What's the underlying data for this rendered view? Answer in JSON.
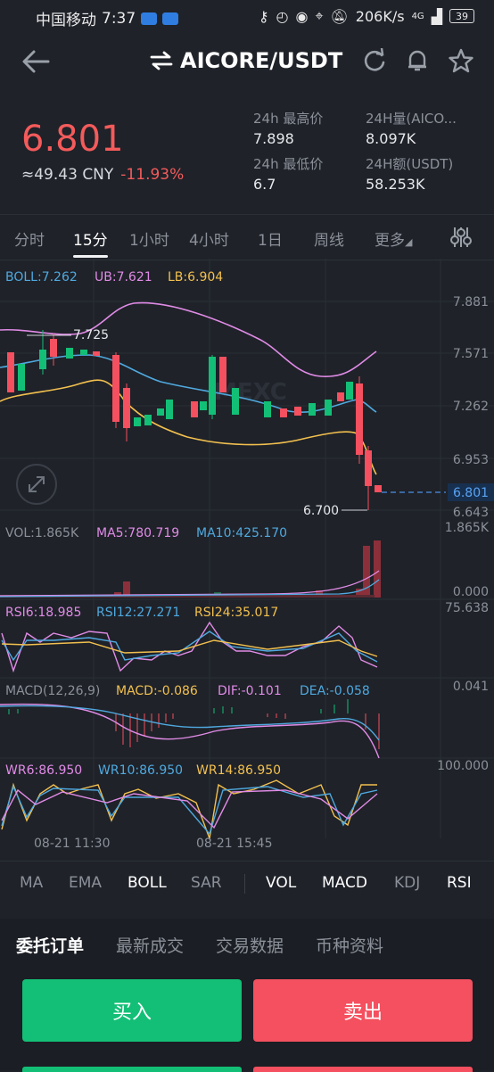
{
  "status": {
    "carrier": "中国移动",
    "time": "7:37",
    "speed": "206K/s",
    "net": "4G",
    "battery": "39"
  },
  "header": {
    "pair": "AICORE/USDT",
    "swap_icon": "swap-icon"
  },
  "price": {
    "last": "6.801",
    "cny": "≈49.43 CNY",
    "change": "-11.93%"
  },
  "stats": [
    {
      "label": "24h 最高价",
      "value": "7.898"
    },
    {
      "label": "24H量(AICO...",
      "value": "8.097K"
    },
    {
      "label": "24h 最低价",
      "value": "6.7"
    },
    {
      "label": "24H额(USDT)",
      "value": "58.253K"
    }
  ],
  "tabs": [
    "分时",
    "15分",
    "1小时",
    "4小时",
    "1日",
    "周线",
    "更多"
  ],
  "boll": {
    "boll": "BOLL:7.262",
    "ub": "UB:7.621",
    "lb": "LB:6.904"
  },
  "price_axis": [
    "7.881",
    "7.571",
    "7.262",
    "6.953",
    "6.643"
  ],
  "price_tag": "6.801",
  "annot_high": "7.725",
  "annot_low": "6.700",
  "vol": {
    "vol": "VOL:1.865K",
    "ma5": "MA5:780.719",
    "ma10": "MA10:425.170",
    "top": "1.865K",
    "bottom": "0.000"
  },
  "rsi": {
    "r6": "RSI6:18.985",
    "r12": "RSI12:27.271",
    "r24": "RSI24:35.017",
    "top": "75.638"
  },
  "macd": {
    "m": "MACD(12,26,9)",
    "macd": "MACD:-0.086",
    "dif": "DIF:-0.101",
    "dea": "DEA:-0.058",
    "top": "0.041"
  },
  "wr": {
    "w6": "WR6:86.950",
    "w10": "WR10:86.950",
    "w14": "WR14:86.950",
    "top": "100.000"
  },
  "time_labels": [
    "08-21 11:30",
    "08-21 15:45"
  ],
  "indicators": [
    "MA",
    "EMA",
    "BOLL",
    "SAR",
    "VOL",
    "MACD",
    "KDJ",
    "RSI"
  ],
  "order_tabs": [
    "委托订单",
    "最新成交",
    "交易数据",
    "币种资料"
  ],
  "buy_label": "买入",
  "sell_label": "卖出",
  "watermark": "MEXC",
  "colors": {
    "up": "#13bf76",
    "down": "#f4505f",
    "ub": "#e08be6",
    "mid": "#4fa9df",
    "lb": "#f2c04f",
    "background": "#1f2229"
  }
}
